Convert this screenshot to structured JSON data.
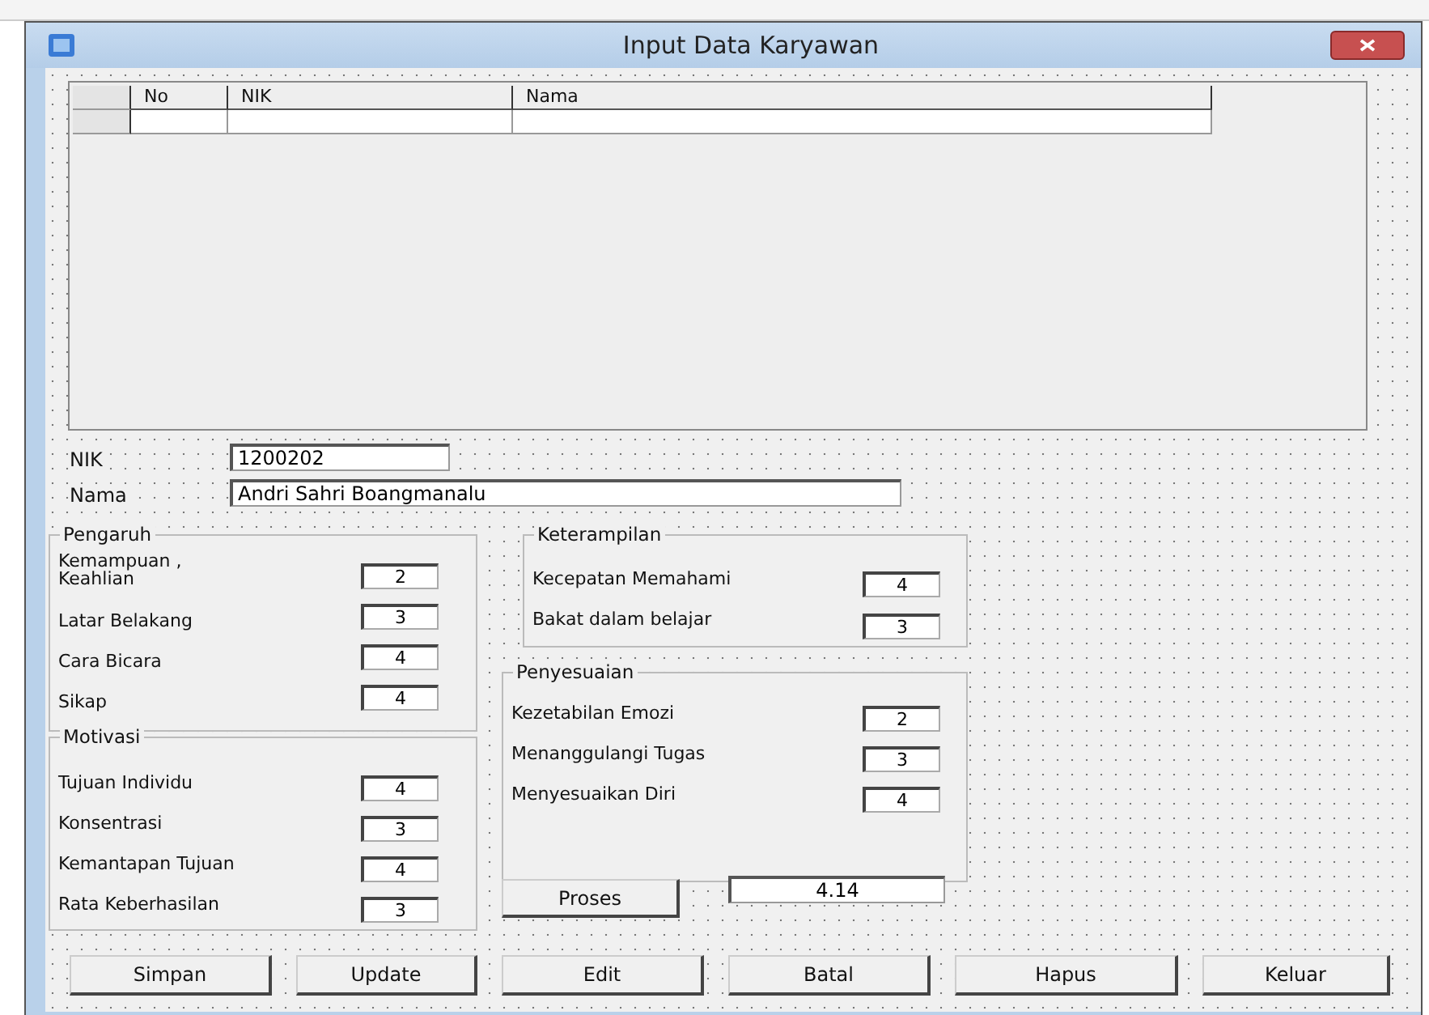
{
  "window": {
    "title": "Input Data  Karyawan"
  },
  "table": {
    "columns": [
      "No",
      "NIK",
      "Nama"
    ]
  },
  "fields": [
    {
      "label": "NIK",
      "value": "1200202"
    },
    {
      "label": "Nama",
      "value": "Andri Sahri Boangmanalu"
    }
  ],
  "groups": [
    {
      "title": "Pengaruh",
      "items": [
        {
          "label": "Kemampuan , Keahlian",
          "value": "2"
        },
        {
          "label": "Latar Belakang",
          "value": "3"
        },
        {
          "label": "Cara Bicara",
          "value": "4"
        },
        {
          "label": "Sikap",
          "value": "4"
        }
      ]
    },
    {
      "title": "Motivasi",
      "items": [
        {
          "label": "Tujuan Individu",
          "value": "4"
        },
        {
          "label": "Konsentrasi",
          "value": "3"
        },
        {
          "label": "Kemantapan Tujuan",
          "value": "4"
        },
        {
          "label": "Rata Keberhasilan",
          "value": "3"
        }
      ]
    },
    {
      "title": "Keterampilan",
      "items": [
        {
          "label": "Kecepatan Memahami",
          "value": "4"
        },
        {
          "label": "Bakat dalam belajar",
          "value": "3"
        }
      ]
    },
    {
      "title": "Penyesuaian",
      "items": [
        {
          "label": "Kezetabilan Emozi",
          "value": "2"
        },
        {
          "label": "Menanggulangi Tugas",
          "value": "3"
        },
        {
          "label": "Menyesuaikan Diri",
          "value": "4"
        }
      ]
    }
  ],
  "process": {
    "button": "Proses",
    "result": "4.14"
  },
  "buttons": [
    "Simpan",
    "Update",
    "Edit",
    "Batal",
    "Hapus",
    "Keluar"
  ]
}
